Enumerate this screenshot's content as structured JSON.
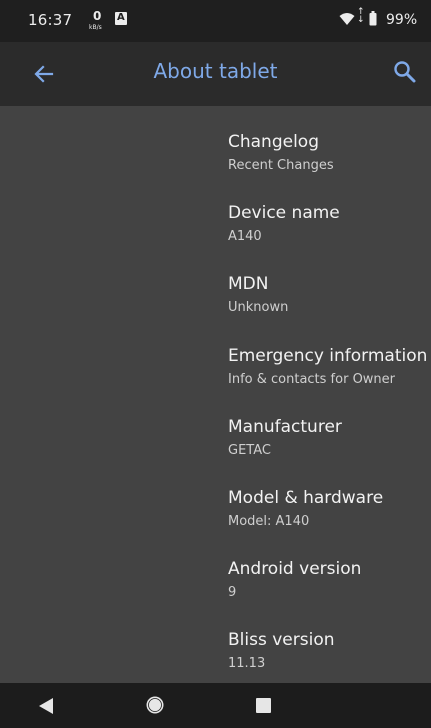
{
  "status_bar": {
    "time": "16:37",
    "net_speed_value": "0",
    "net_speed_unit": "kB/s",
    "notification_letter": "A",
    "battery": "99%"
  },
  "app_bar": {
    "title": "About tablet",
    "back_icon": "arrow-left-icon",
    "search_icon": "search-icon",
    "accent_color": "#7fa9e8"
  },
  "items": [
    {
      "title": "Changelog",
      "summary": "Recent Changes"
    },
    {
      "title": "Device name",
      "summary": "A140"
    },
    {
      "title": "MDN",
      "summary": "Unknown"
    },
    {
      "title": "Emergency information",
      "summary": "Info & contacts for Owner"
    },
    {
      "title": "Manufacturer",
      "summary": "GETAC"
    },
    {
      "title": "Model & hardware",
      "summary": "Model: A140"
    },
    {
      "title": "Android version",
      "summary": "9"
    },
    {
      "title": "Bliss version",
      "summary": "11.13"
    }
  ],
  "nav_bar": {
    "back": "triangle-back-icon",
    "home": "circle-home-icon",
    "recents": "square-recents-icon"
  }
}
